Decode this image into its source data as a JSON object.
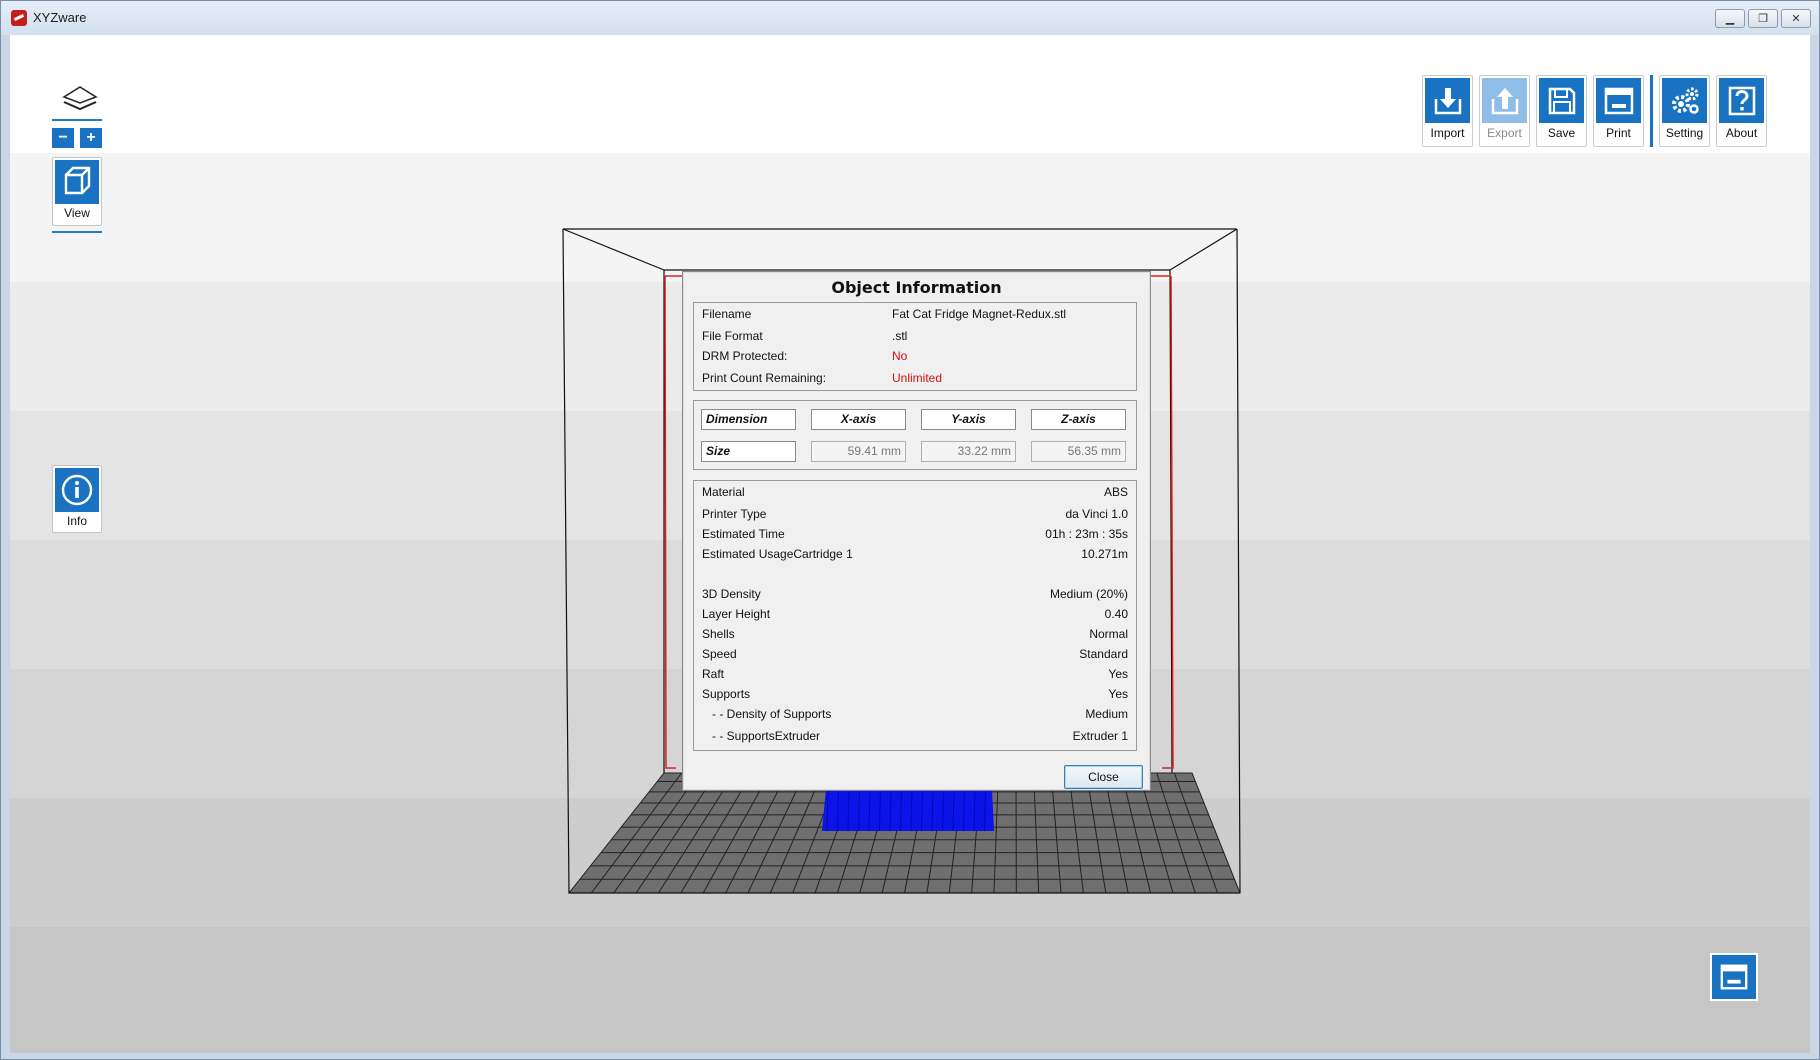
{
  "window": {
    "title": "XYZware",
    "controls": [
      "minimize",
      "maximize",
      "close"
    ]
  },
  "left_panel": {
    "zoom_out": "−",
    "zoom_in": "+",
    "view_label": "View",
    "info_label": "Info"
  },
  "toolbar": {
    "buttons": [
      {
        "label": "Import",
        "icon": "import-icon",
        "enabled": true
      },
      {
        "label": "Export",
        "icon": "export-icon",
        "enabled": false
      },
      {
        "label": "Save",
        "icon": "save-icon",
        "enabled": true
      },
      {
        "label": "Print",
        "icon": "print-icon",
        "enabled": true
      },
      {
        "label": "Setting",
        "icon": "gears-icon",
        "enabled": true
      },
      {
        "label": "About",
        "icon": "help-icon",
        "enabled": true
      }
    ]
  },
  "dialog": {
    "title": "Object Information",
    "file_info": {
      "filename_label": "Filename",
      "filename": "Fat Cat Fridge Magnet-Redux.stl",
      "format_label": "File Format",
      "format": ".stl",
      "drm_label": "DRM Protected:",
      "drm": "No",
      "print_count_label": "Print Count Remaining:",
      "print_count": "Unlimited"
    },
    "dimension": {
      "header": "Dimension",
      "x_header": "X-axis",
      "y_header": "Y-axis",
      "z_header": "Z-axis",
      "size_label": "Size",
      "x": "59.41 mm",
      "y": "33.22 mm",
      "z": "56.35 mm"
    },
    "print_info": [
      {
        "label": "Material",
        "value": "ABS"
      },
      {
        "label": "Printer Type",
        "value": "da Vinci 1.0"
      },
      {
        "label": "Estimated Time",
        "value": "01h : 23m : 35s"
      },
      {
        "label": "Estimated UsageCartridge 1",
        "value": "10.271m"
      },
      {
        "label": "3D Density",
        "value": "Medium (20%)"
      },
      {
        "label": "Layer Height",
        "value": "0.40"
      },
      {
        "label": "Shells",
        "value": "Normal"
      },
      {
        "label": "Speed",
        "value": "Standard"
      },
      {
        "label": "Raft",
        "value": "Yes"
      },
      {
        "label": "Supports",
        "value": "Yes"
      },
      {
        "label": "- - Density of Supports",
        "value": "Medium"
      },
      {
        "label": "- - SupportsExtruder",
        "value": "Extruder 1"
      }
    ],
    "close_label": "Close"
  },
  "colors": {
    "accent": "#1a73c2",
    "warning_text": "#d81010",
    "model": "#0a14e6"
  }
}
